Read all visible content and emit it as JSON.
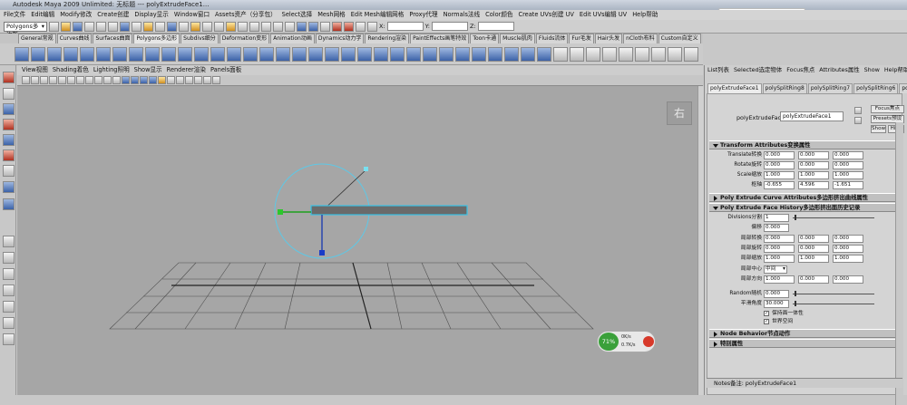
{
  "window": {
    "title": "Autodesk Maya 2009 Unlimited: 无标题   ---   polyExtrudeFace1..."
  },
  "menubar": [
    "File文件",
    "Edit编辑",
    "Modify修改",
    "Create创建",
    "Display显示",
    "Window窗口",
    "Assets资产（分享包）",
    "Select选择",
    "Mesh网格",
    "Edit Mesh编辑网格",
    "Proxy代理",
    "Normals法线",
    "Color颜色",
    "Create UVs创建 UV",
    "Edit UVs编辑 UV",
    "Help帮助"
  ],
  "status": {
    "menuset": "Polygons多边形",
    "x_label": "X:",
    "y_label": "Y:",
    "z_label": "Z:"
  },
  "shelf_tabs": [
    "General常规",
    "Curves曲线",
    "Surfaces曲面",
    "Polygons多边形",
    "Subdivs细分",
    "Deformation变形",
    "Animation动画",
    "Dynamics动力学",
    "Rendering渲染",
    "PaintEffects画笔特效",
    "Toon卡通",
    "Muscle肌肉",
    "Fluids流体",
    "Fur毛发",
    "Hair头发",
    "nCloth布料",
    "Custom自定义"
  ],
  "active_shelf": "Polygons多边形",
  "panel_menu": [
    "View视图",
    "Shading着色",
    "Lighting照明",
    "Show显示",
    "Renderer渲染",
    "Panels面板"
  ],
  "viewcube_label": "右",
  "hud": {
    "percent": "71%",
    "line1": "0K/s",
    "line2": "0.7K/s"
  },
  "attribute_editor": {
    "menu": [
      "List列表",
      "Selected选定物体",
      "Focus焦点",
      "Attributes属性",
      "Show",
      "Help帮助"
    ],
    "node_tabs": [
      "polyExtrudeFace1",
      "polySplitRing8",
      "polySplitRing7",
      "polySplitRing6",
      "polySplit"
    ],
    "node_label": "polyExtrudeFace:",
    "node_value": "polyExtrudeFace1",
    "buttons": {
      "focus": "Focus焦点",
      "presets": "Presets预设",
      "show": "Show",
      "hide": "Hide"
    },
    "sections": {
      "transform": "Transform Attributes变换属性",
      "curve": "Poly Extrude Curve Attributes多边形挤出曲线属性",
      "history": "Poly Extrude Face History多边形挤出面历史记录",
      "node_behavior": "Node Behavior节点动作",
      "extra": "特别属性"
    },
    "transform_rows": [
      {
        "label": "Translate转换",
        "values": [
          "0.000",
          "0.000",
          "0.000"
        ]
      },
      {
        "label": "Rotate旋转",
        "values": [
          "0.000",
          "0.000",
          "0.000"
        ]
      },
      {
        "label": "Scale缩放",
        "values": [
          "1.000",
          "1.000",
          "1.000"
        ]
      },
      {
        "label": "枢轴",
        "values": [
          "-0.655",
          "4.596",
          "-1.651"
        ]
      }
    ],
    "divisions": {
      "label": "Divisions分割",
      "value": "1"
    },
    "offset": {
      "label": "偏移",
      "value": "0.000"
    },
    "history_rows": [
      {
        "label": "局部转换",
        "values": [
          "0.000",
          "0.000",
          "0.000"
        ]
      },
      {
        "label": "局部旋转",
        "values": [
          "0.000",
          "0.000",
          "0.000"
        ]
      },
      {
        "label": "局部缩放",
        "values": [
          "1.000",
          "1.000",
          "1.000"
        ]
      }
    ],
    "local_center": {
      "label": "局部中心",
      "value": "中间"
    },
    "local_direction": {
      "label": "局部方向",
      "values": [
        "1.000",
        "0.000",
        "0.000"
      ]
    },
    "random": {
      "label": "Random随机",
      "value": "0.000"
    },
    "smoothing": {
      "label": "平滑角度",
      "value": "30.000"
    },
    "keep_faces": "保持面一体性",
    "world_space": "世界空间",
    "notes": "Notes备注: polyExtrudeFace1"
  }
}
